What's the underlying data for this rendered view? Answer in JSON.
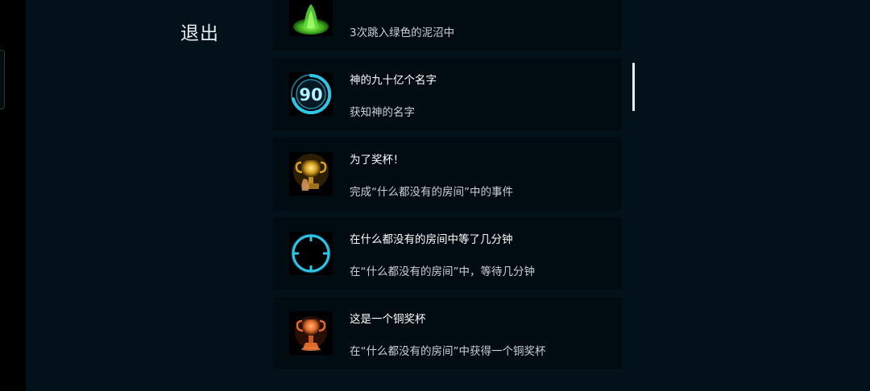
{
  "exit_label": "退出",
  "achievements": [
    {
      "title": "",
      "desc": "3次跳入绿色的泥沼中",
      "icon": "green-swamp-icon"
    },
    {
      "title": "神的九十亿个名字",
      "desc": "获知神的名字",
      "icon": "number-90-badge-icon",
      "badge_text": "90"
    },
    {
      "title": "为了奖杯！",
      "desc": "完成“什么都没有的房间”中的事件",
      "icon": "gold-trophy-icon"
    },
    {
      "title": "在什么都没有的房间中等了几分钟",
      "desc": "在“什么都没有的房间”中，等待几分钟",
      "icon": "clock-ring-icon"
    },
    {
      "title": "这是一个铜奖杯",
      "desc": "在“什么都没有的房间”中获得一个铜奖杯",
      "icon": "bronze-trophy-icon"
    }
  ],
  "colors": {
    "background": "#03111a",
    "card": "#010b12",
    "accent_cyan": "#2ec6e8",
    "gold": "#d9a21e",
    "bronze": "#e06a2a",
    "green": "#5ee03a"
  }
}
